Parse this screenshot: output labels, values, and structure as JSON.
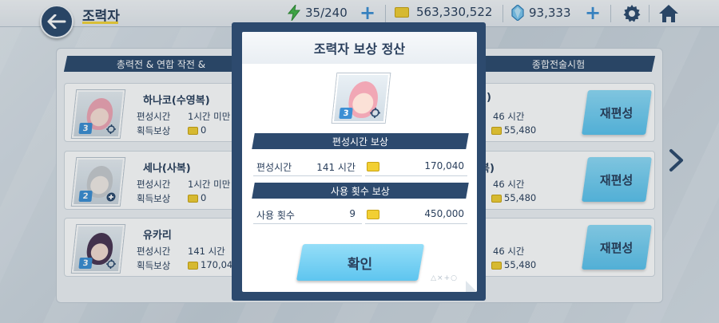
{
  "header": {
    "title": "조력자",
    "stamina": "35/240",
    "credits": "563,330,522",
    "gems": "93,333"
  },
  "bands": {
    "left": "총력전 & 연합 작전 &",
    "right": "종합전술시험"
  },
  "left_cards": [
    {
      "name": "하나코(수영복)",
      "time_label": "편성시간",
      "time_value": "1시간 미만",
      "reward_label": "획득보상",
      "reward_value": "0",
      "star": "3"
    },
    {
      "name": "세나(사복)",
      "time_label": "편성시간",
      "time_value": "1시간 미만",
      "reward_label": "획득보상",
      "reward_value": "0",
      "star": "2"
    },
    {
      "name": "유카리",
      "time_label": "편성시간",
      "time_value": "141 시간",
      "reward_label": "획득보상",
      "reward_value": "170,04",
      "star": "3"
    }
  ],
  "right_cards": [
    {
      "name_fragment": ")",
      "time_value": "46 시간",
      "reward_value": "55,480",
      "button": "재편성"
    },
    {
      "name_fragment": "복)",
      "time_value": "46 시간",
      "reward_value": "55,480",
      "button": "재편성"
    },
    {
      "name_fragment": "",
      "time_value": "46 시간",
      "reward_value": "55,480",
      "button": "재편성"
    }
  ],
  "modal": {
    "title": "조력자 보상 정산",
    "star": "3",
    "section1": "편성시간 보상",
    "row1_label": "편성시간",
    "row1_value": "141 시간",
    "row1_reward": "170,040",
    "section2": "사용 횟수 보상",
    "row2_label": "사용 횟수",
    "row2_value": "9",
    "row2_reward": "450,000",
    "confirm": "확인",
    "deco": "△×+○"
  },
  "colors": {
    "navy": "#2d4a6e",
    "accent_blue": "#3c8fd4",
    "button_cyan": "#5ec5ef",
    "coin_gold": "#f2cf33",
    "stamina_green": "#45b649"
  },
  "icons": [
    "back-arrow-icon",
    "stamina-bolt-icon",
    "credit-coin-icon",
    "gem-icon",
    "settings-gear-icon",
    "home-icon",
    "next-arrow-icon",
    "crosshair-icon"
  ]
}
